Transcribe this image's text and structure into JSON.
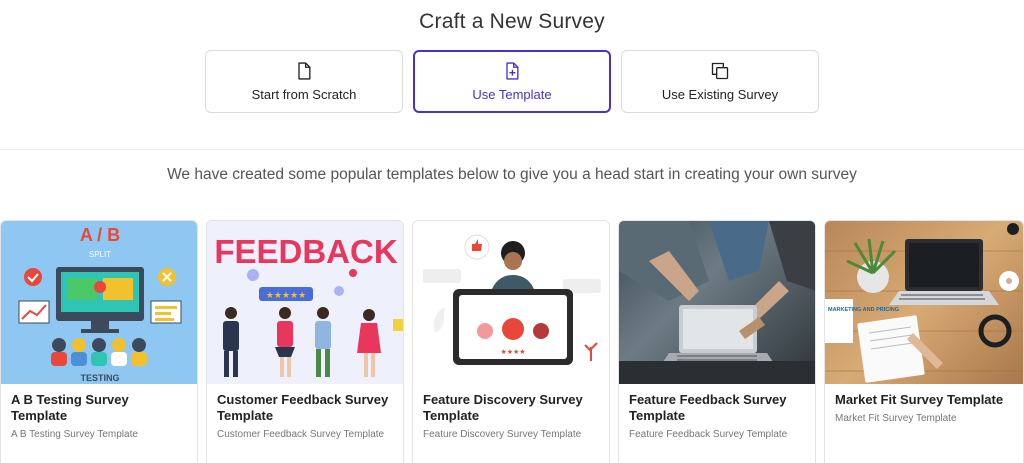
{
  "header": {
    "title": "Craft a New Survey"
  },
  "options": [
    {
      "label": "Start from Scratch",
      "icon": "file-icon",
      "active": false
    },
    {
      "label": "Use Template",
      "icon": "file-plus-icon",
      "active": true
    },
    {
      "label": "Use Existing Survey",
      "icon": "copy-icon",
      "active": false
    }
  ],
  "subtitle": "We have created some popular templates below to give you a head start in creating your own survey",
  "templates": [
    {
      "title": "A B Testing Survey Template",
      "subtitle": "A B Testing Survey Template",
      "image": {
        "top": "A / B",
        "mid": "SPLIT",
        "bottom": "TESTING"
      }
    },
    {
      "title": "Customer Feedback Survey Template",
      "subtitle": "Customer Feedback Survey Template",
      "image": {
        "word": "FEEDBACK",
        "stars": "★★★★★"
      }
    },
    {
      "title": "Feature Discovery Survey Template",
      "subtitle": "Feature Discovery Survey Template",
      "image": {
        "stars": "★★★★"
      }
    },
    {
      "title": "Feature Feedback Survey Template",
      "subtitle": "Feature Feedback Survey Template",
      "image": {}
    },
    {
      "title": "Market Fit Survey Template",
      "subtitle": "Market Fit Survey Template",
      "image": {
        "book": "MARKETING AND PRICING"
      }
    }
  ],
  "colors": {
    "accent": "#4b2fd0",
    "border": "#dcdcdc"
  }
}
